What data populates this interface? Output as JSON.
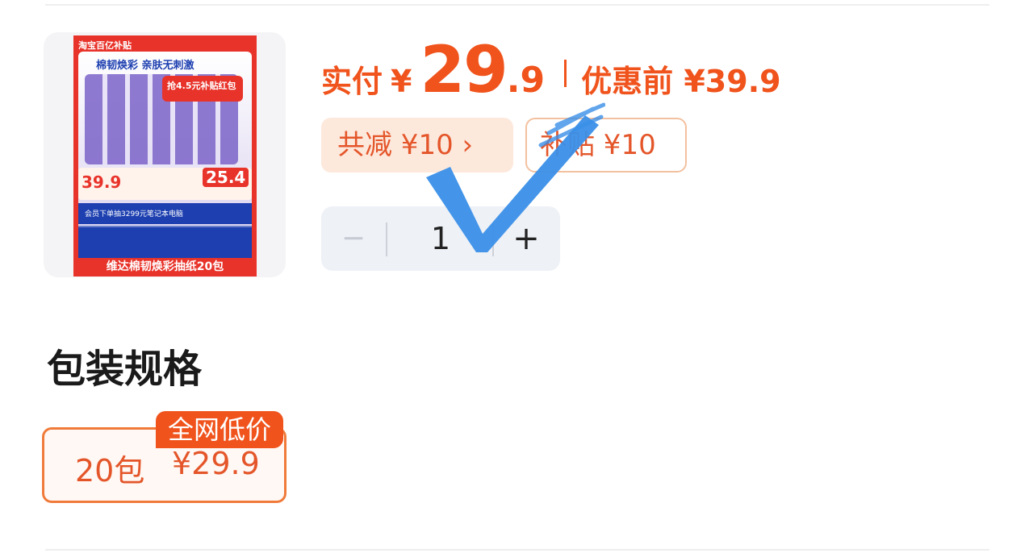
{
  "product": {
    "image": {
      "brand": "淘宝百亿补贴",
      "slogan": "棉韧焕彩 亲肤无刺激",
      "redpack": "抢4.5元补贴红包",
      "price_before": "39.9",
      "price_after": "25.4",
      "promo_line": "会员下单抽3299元笔记本电脑",
      "footer": "维达棉韧焕彩抽纸20包"
    }
  },
  "price": {
    "pay_label": "实付",
    "currency": "¥",
    "amount_int": "29",
    "amount_dec": ".9",
    "original_label": "优惠前 ¥39.9"
  },
  "tags": {
    "discount": "共减 ¥10 ›",
    "subsidy": "补贴 ¥10"
  },
  "quantity": {
    "minus": "−",
    "value": "1",
    "plus": "+"
  },
  "spec": {
    "title": "包装规格",
    "options": [
      {
        "label": "20包",
        "price": "¥29.9",
        "badge": "全网低价",
        "selected": true
      }
    ]
  },
  "colors": {
    "accent": "#f0531c",
    "tag_bg": "#fde8dc",
    "stepper_bg": "#eef1f6",
    "checkmark": "#3a8fe8"
  }
}
